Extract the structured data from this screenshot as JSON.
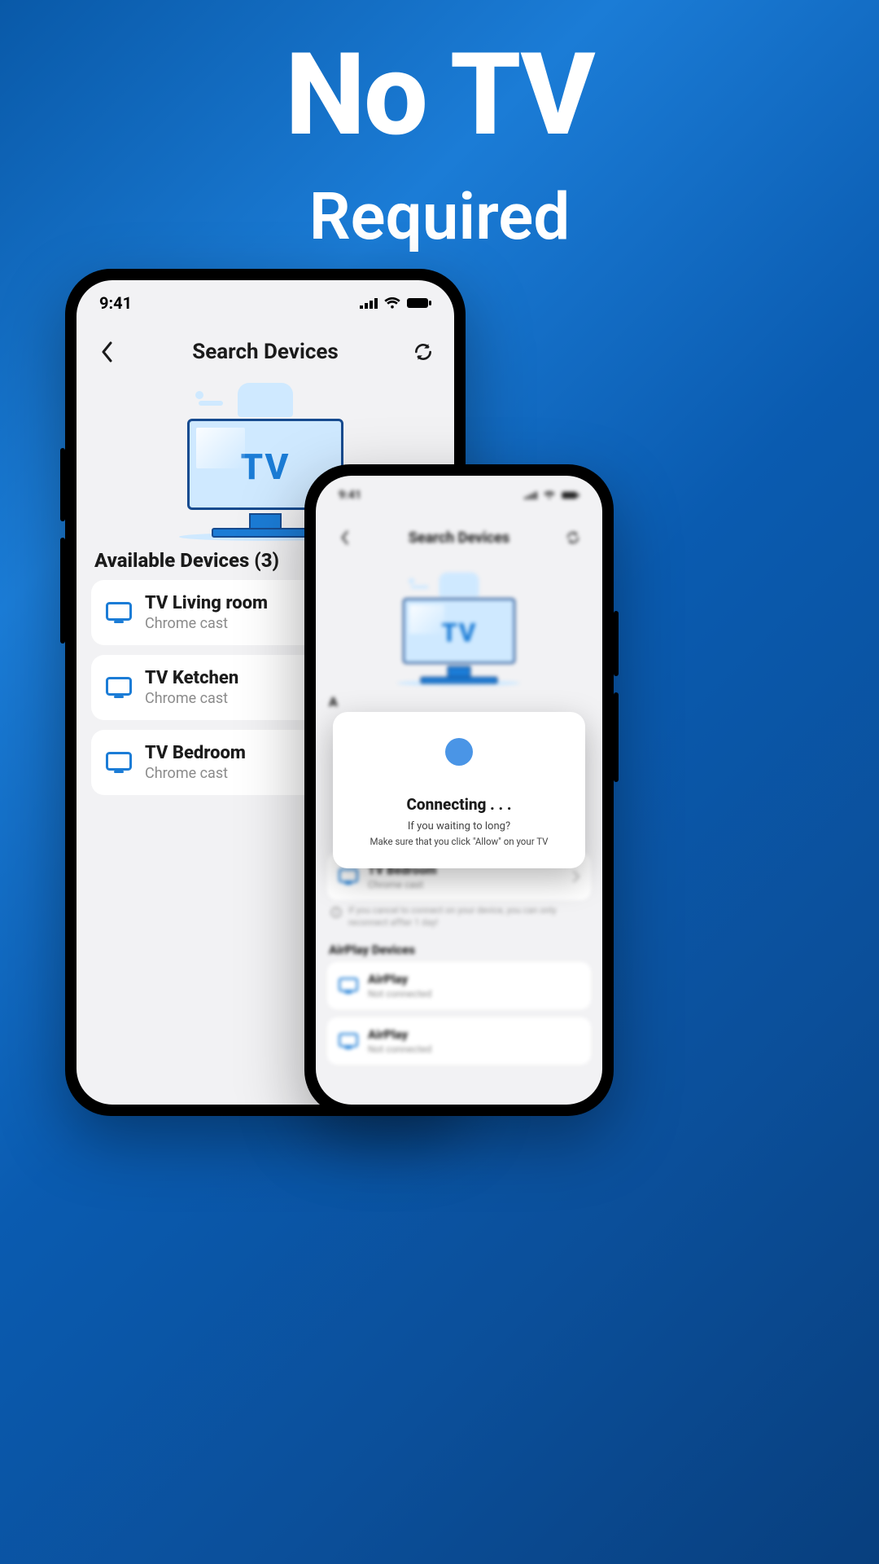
{
  "headline": {
    "line1": "No TV",
    "line2": "Required"
  },
  "status_time": "9:41",
  "phone_a": {
    "title": "Search Devices",
    "tv_label": "TV",
    "section_label": "Available Devices (3)",
    "devices": [
      {
        "name": "TV Living room",
        "sub": "Chrome cast"
      },
      {
        "name": "TV Ketchen",
        "sub": "Chrome cast"
      },
      {
        "name": "TV Bedroom",
        "sub": "Chrome cast"
      }
    ]
  },
  "phone_b": {
    "title": "Search Devices",
    "tv_label": "TV",
    "available_label": "A",
    "bedroom": {
      "name": "TV Bedroom",
      "sub": "Chrome cast"
    },
    "note": "If you cancel to connect on your device, you can only reconnect affter 1 day!",
    "airplay_section": "AirPlay Devices",
    "airplay": [
      {
        "name": "AirPlay",
        "sub": "Not connected"
      },
      {
        "name": "AirPlay",
        "sub": "Not connected"
      }
    ],
    "modal": {
      "title": "Connecting . . .",
      "line1": "If you waiting to long?",
      "line2": "Make  sure that you click \"Allow\" on your TV"
    }
  }
}
